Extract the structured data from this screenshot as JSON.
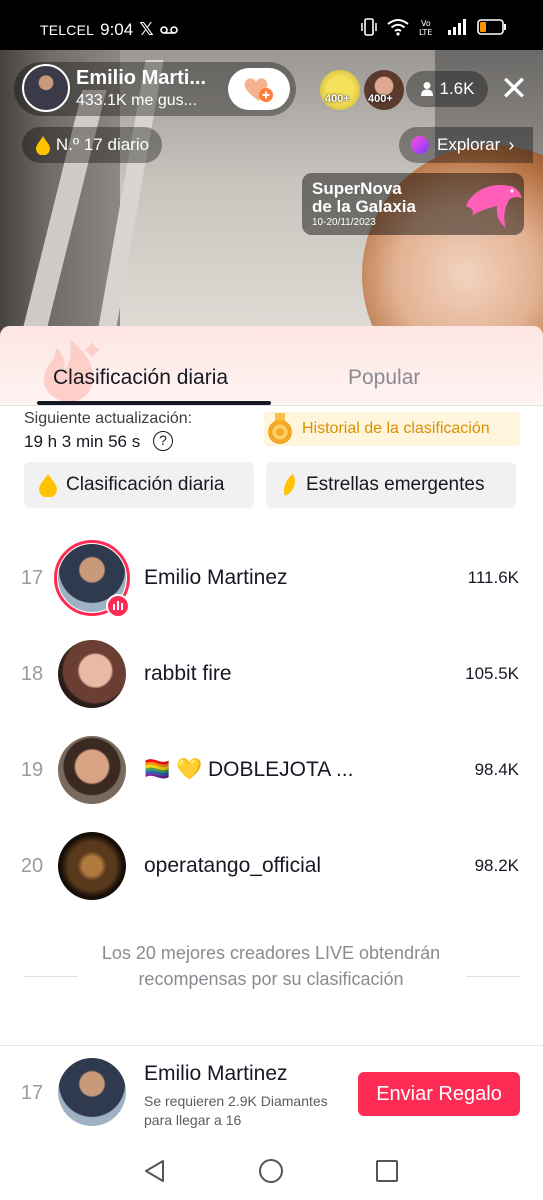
{
  "status_bar": {
    "carrier": "TELCEL",
    "time": "9:04",
    "battery_color": "#ff9500"
  },
  "live": {
    "host_name": "Emilio Marti...",
    "host_likes": "433.1K me gus...",
    "viewer_badges": [
      "400+",
      "400+"
    ],
    "viewer_count": "1.6K",
    "daily_rank": "N.º 17 diario",
    "explore_label": "Explorar",
    "promo": {
      "line1": "SuperNova",
      "line2": "de la Galaxia",
      "dates": "10-20/11/2023"
    },
    "icons": {
      "follow": "heart-plus-icon",
      "close": "close-icon",
      "viewers": "person-icon",
      "explore": "chevron-right-icon"
    }
  },
  "sheet": {
    "tabs": [
      {
        "label": "Clasificación diaria",
        "active": true
      },
      {
        "label": "Popular",
        "active": false
      }
    ],
    "next_update_label": "Siguiente actualización:",
    "countdown": "19 h 3 min 56 s",
    "history_label": "Historial de la clasificación",
    "chips": [
      {
        "label": "Clasificación diaria",
        "icon": "drop-icon",
        "selected": true
      },
      {
        "label": "Estrellas emergentes",
        "icon": "leaf-icon",
        "selected": false
      }
    ],
    "rows": [
      {
        "rank": "17",
        "name": "Emilio Martinez",
        "score": "111.6K",
        "live": true
      },
      {
        "rank": "18",
        "name": "rabbit fire",
        "score": "105.5K",
        "live": false
      },
      {
        "rank": "19",
        "name": "🏳️‍🌈 💛 DOBLEJOTA ...",
        "score": "98.4K",
        "live": false
      },
      {
        "rank": "20",
        "name": "operatango_official",
        "score": "98.2K",
        "live": false
      }
    ],
    "footer_note": "Los 20 mejores creadores LIVE obtendrán recompensas por su clasificación",
    "me": {
      "rank": "17",
      "name": "Emilio Martinez",
      "subtitle": "Se requieren 2.9K Diamantes para llegar a 16",
      "button": "Enviar Regalo"
    },
    "colors": {
      "accent": "#fe2c55",
      "gold": "#d99100",
      "text": "#161823",
      "muted": "#8a8b91"
    }
  }
}
